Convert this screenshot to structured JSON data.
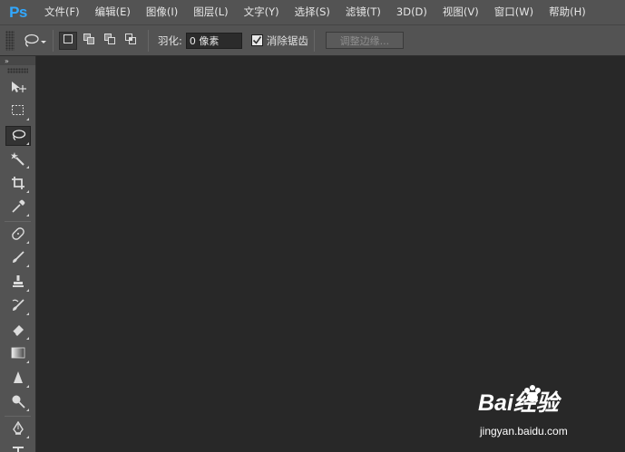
{
  "app": {
    "logo": "Ps"
  },
  "menu": [
    {
      "label": "文件(F)"
    },
    {
      "label": "编辑(E)"
    },
    {
      "label": "图像(I)"
    },
    {
      "label": "图层(L)"
    },
    {
      "label": "文字(Y)"
    },
    {
      "label": "选择(S)"
    },
    {
      "label": "滤镜(T)"
    },
    {
      "label": "3D(D)"
    },
    {
      "label": "视图(V)"
    },
    {
      "label": "窗口(W)"
    },
    {
      "label": "帮助(H)"
    }
  ],
  "options": {
    "feather_label": "羽化:",
    "feather_value": "0 像素",
    "antialias_label": "消除锯齿",
    "antialias_checked": true,
    "refine_edge_label": "调整边缘..."
  },
  "toolbar": {
    "collapse_glyph": "»",
    "tools": [
      {
        "name": "move-tool",
        "icon": "move-icon"
      },
      {
        "name": "marquee-tool",
        "icon": "rectangular-marquee-icon"
      },
      {
        "name": "lasso-tool",
        "icon": "lasso-icon",
        "active": true
      },
      {
        "name": "magic-wand-tool",
        "icon": "magic-wand-icon"
      },
      {
        "name": "crop-tool",
        "icon": "crop-icon"
      },
      {
        "name": "eyedropper-tool",
        "icon": "eyedropper-icon"
      },
      {
        "name": "healing-brush-tool",
        "icon": "bandage-icon"
      },
      {
        "name": "brush-tool",
        "icon": "brush-icon"
      },
      {
        "name": "clone-stamp-tool",
        "icon": "stamp-icon"
      },
      {
        "name": "history-brush-tool",
        "icon": "history-brush-icon"
      },
      {
        "name": "eraser-tool",
        "icon": "eraser-icon"
      },
      {
        "name": "gradient-tool",
        "icon": "gradient-icon"
      },
      {
        "name": "blur-tool",
        "icon": "blur-icon"
      },
      {
        "name": "dodge-tool",
        "icon": "dodge-icon"
      },
      {
        "name": "pen-tool",
        "icon": "pen-icon"
      },
      {
        "name": "type-tool",
        "icon": "type-icon"
      }
    ]
  },
  "watermark": {
    "brand": "Bai经验",
    "url": "jingyan.baidu.com"
  }
}
